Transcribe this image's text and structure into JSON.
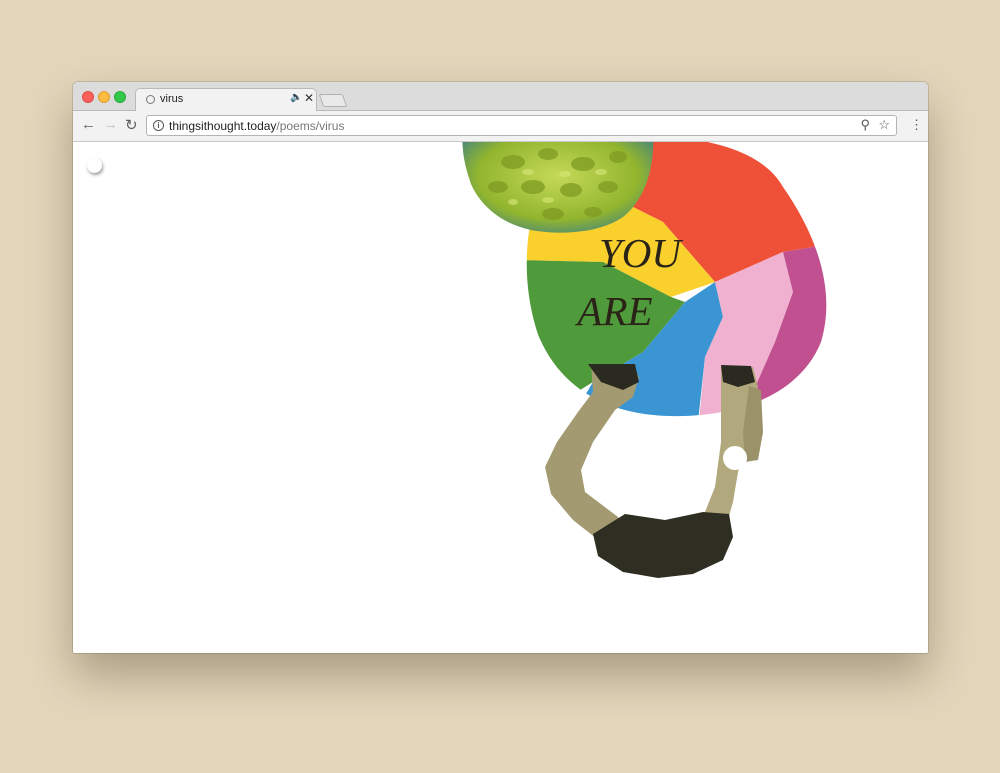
{
  "browser": {
    "tab": {
      "title": "virus"
    },
    "address_bar": {
      "host": "thingsithought.today",
      "path": "/poems/virus"
    },
    "icons": [
      "back-arrow-icon",
      "forward-arrow-icon",
      "reload-icon",
      "info-icon",
      "zoom-icon",
      "star-icon",
      "menu-icon",
      "audio-icon",
      "close-icon"
    ]
  },
  "page": {
    "poem_lines": [
      "YOU",
      "ARE"
    ]
  },
  "colors": {
    "desktop": "#e3d6bb",
    "ball_red": "#ef5138",
    "ball_yellow": "#fad02c",
    "ball_green": "#4f9a3a",
    "ball_blue": "#3c95d3",
    "ball_pink": "#efb1cf",
    "ball_magenta": "#c0508f",
    "virus_green": "#a6c43a"
  }
}
